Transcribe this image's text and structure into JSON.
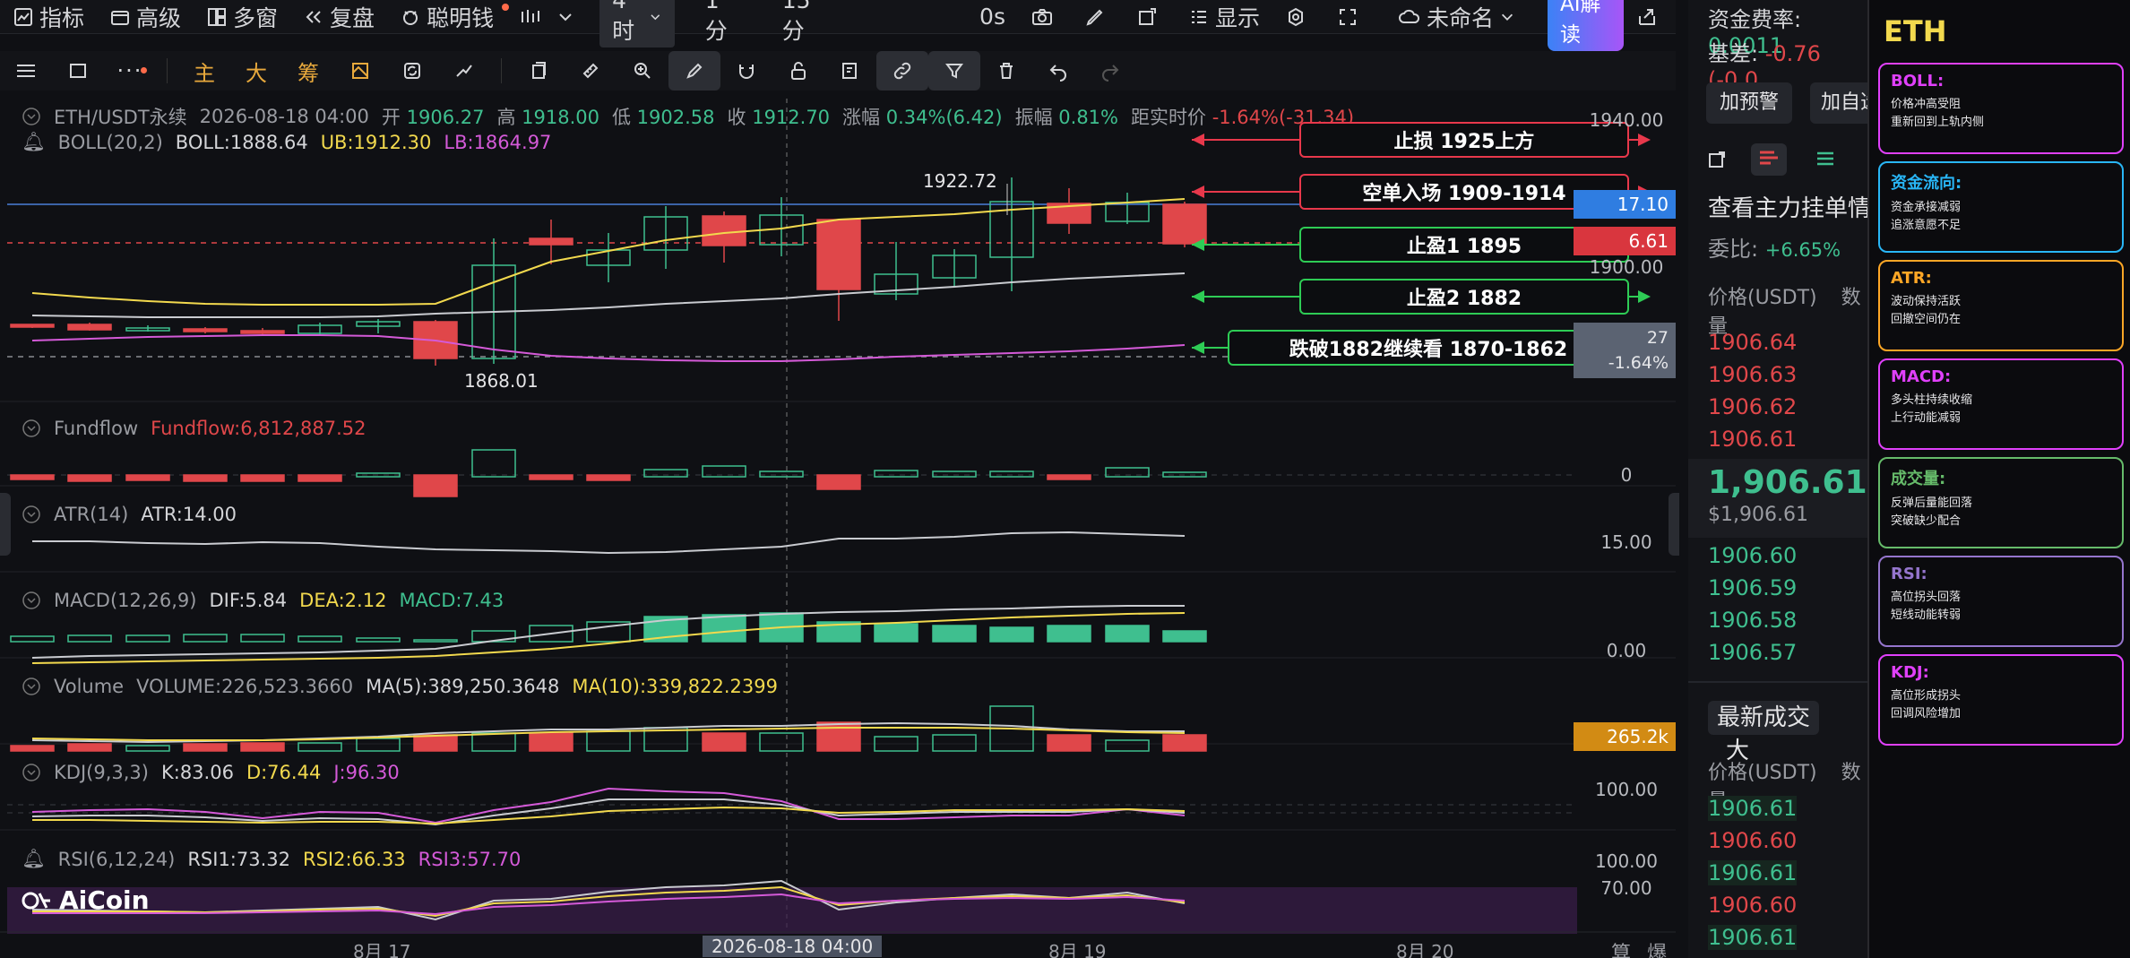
{
  "toolbar": {
    "indicators": "指标",
    "advanced": "高级",
    "multiwindow": "多窗",
    "replay": "复盘",
    "smart_money": "聪明钱",
    "timeframe_selected": "4时",
    "tf_1m": "1分",
    "tf_15m": "15分",
    "countdown": "0s",
    "display": "显示",
    "layout_name": "未命名",
    "ai_button": "AI解读"
  },
  "toolbar2": {
    "main": "主",
    "big": "大",
    "chip": "筹"
  },
  "chart_header": {
    "symbol": "ETH/USDT永续",
    "time": "2026-08-18 04:00",
    "open_label": "开",
    "open": "1906.27",
    "high_label": "高",
    "high": "1918.00",
    "low_label": "低",
    "low": "1902.58",
    "close_label": "收",
    "close": "1912.70",
    "change_label": "涨幅",
    "change": "0.34%(6.42)",
    "amp_label": "振幅",
    "amp": "0.81%",
    "dist_label": "距实时价",
    "dist": "-1.64%(-31.34)"
  },
  "indicators": {
    "boll": {
      "name": "BOLL(20,2)",
      "boll": "BOLL:1888.64",
      "ub": "UB:1912.30",
      "lb": "LB:1864.97"
    },
    "fundflow": {
      "name": "Fundflow",
      "value": "Fundflow:6,812,887.52"
    },
    "atr": {
      "name": "ATR(14)",
      "value": "ATR:14.00"
    },
    "macd": {
      "name": "MACD(12,26,9)",
      "dif": "DIF:5.84",
      "dea": "DEA:2.12",
      "macd": "MACD:7.43"
    },
    "volume": {
      "name": "Volume",
      "vol": "VOLUME:226,523.3660",
      "ma5": "MA(5):389,250.3648",
      "ma10": "MA(10):339,822.2399"
    },
    "kdj": {
      "name": "KDJ(9,3,3)",
      "k": "K:83.06",
      "d": "D:76.44",
      "j": "J:96.30"
    },
    "rsi": {
      "name": "RSI(6,12,24)",
      "r1": "RSI1:73.32",
      "r2": "RSI2:66.33",
      "r3": "RSI3:57.70"
    }
  },
  "axis": {
    "price_top": "1940.00",
    "price_mid": "1900.00",
    "fund_zero": "0",
    "atr": "15.00",
    "macd": "0.00",
    "vol_tag": "265.2k",
    "kdj": "100.00",
    "rsi_top": "100.00",
    "rsi_70": "70.00",
    "tag_blue": "17.10",
    "tag_red": "6.61",
    "tag_grey_1": "27",
    "tag_grey_2": "-1.64%",
    "dates": [
      "8月 17",
      "8月 19",
      "8月 20"
    ],
    "cursor_date": "2026-08-18 04:00",
    "right_tools": [
      "算",
      "爆"
    ]
  },
  "annotations": {
    "high_marker": "1922.72",
    "low_marker": "1868.01",
    "stop_loss": "止损 1925上方",
    "entry": "空单入场 1909-1914",
    "tp1": "止盈1 1895",
    "tp2": "止盈2 1882",
    "breakdown": "跌破1882继续看 1870-1862"
  },
  "brand": "AiCoin",
  "orderbook": {
    "funding_label": "资金费率:",
    "funding_value": "0.0011",
    "basis_label": "基差:",
    "basis_value": "-0.76 (-0.0",
    "alert_btn": "加预警",
    "watch_btn": "加自选",
    "big_orders": "查看主力挂单情",
    "ratio_label": "委比:",
    "ratio_value": "+6.65%",
    "price_header": "价格(USDT)",
    "qty_header": "数量",
    "asks": [
      "1906.64",
      "1906.63",
      "1906.62",
      "1906.61"
    ],
    "last_price": "1,906.61",
    "last_usd": "$1,906.61",
    "bids": [
      "1906.60",
      "1906.59",
      "1906.58",
      "1906.57"
    ],
    "trades_tab": "最新成交",
    "big_tab": "大",
    "trades_price_header": "价格(USDT)",
    "trades_qty_header": "数量",
    "trades": [
      {
        "p": "1906.61",
        "c": "#3fbf8f"
      },
      {
        "p": "1906.60",
        "c": "#e0474a"
      },
      {
        "p": "1906.61",
        "c": "#3fbf8f"
      },
      {
        "p": "1906.60",
        "c": "#e0474a"
      },
      {
        "p": "1906.61",
        "c": "#3fbf8f"
      }
    ]
  },
  "analysis": {
    "title": "ETH",
    "cards": [
      {
        "title": "BOLL:",
        "color": "#e040fb",
        "tc": "#e040fb",
        "lines": [
          "价格冲高受阻",
          "重新回到上轨内侧"
        ]
      },
      {
        "title": "资金流向:",
        "color": "#29b6f6",
        "tc": "#29b6f6",
        "lines": [
          "资金承接减弱",
          "追涨意愿不足"
        ]
      },
      {
        "title": "ATR:",
        "color": "#ffa726",
        "tc": "#ffa726",
        "lines": [
          "波动保持活跃",
          "回撤空间仍在"
        ]
      },
      {
        "title": "MACD:",
        "color": "#e040fb",
        "tc": "#e040fb",
        "lines": [
          "多头柱持续收缩",
          "上行动能减弱"
        ]
      },
      {
        "title": "成交量:",
        "color": "#66bb6a",
        "tc": "#66bb6a",
        "lines": [
          "反弹后量能回落",
          "突破缺少配合"
        ]
      },
      {
        "title": "RSI:",
        "color": "#9575cd",
        "tc": "#9575cd",
        "lines": [
          "高位拐头回落",
          "短线动能转弱"
        ]
      },
      {
        "title": "KDJ:",
        "color": "#e040fb",
        "tc": "#e040fb",
        "lines": [
          "高位形成拐头",
          "回调风险增加"
        ]
      }
    ]
  }
}
